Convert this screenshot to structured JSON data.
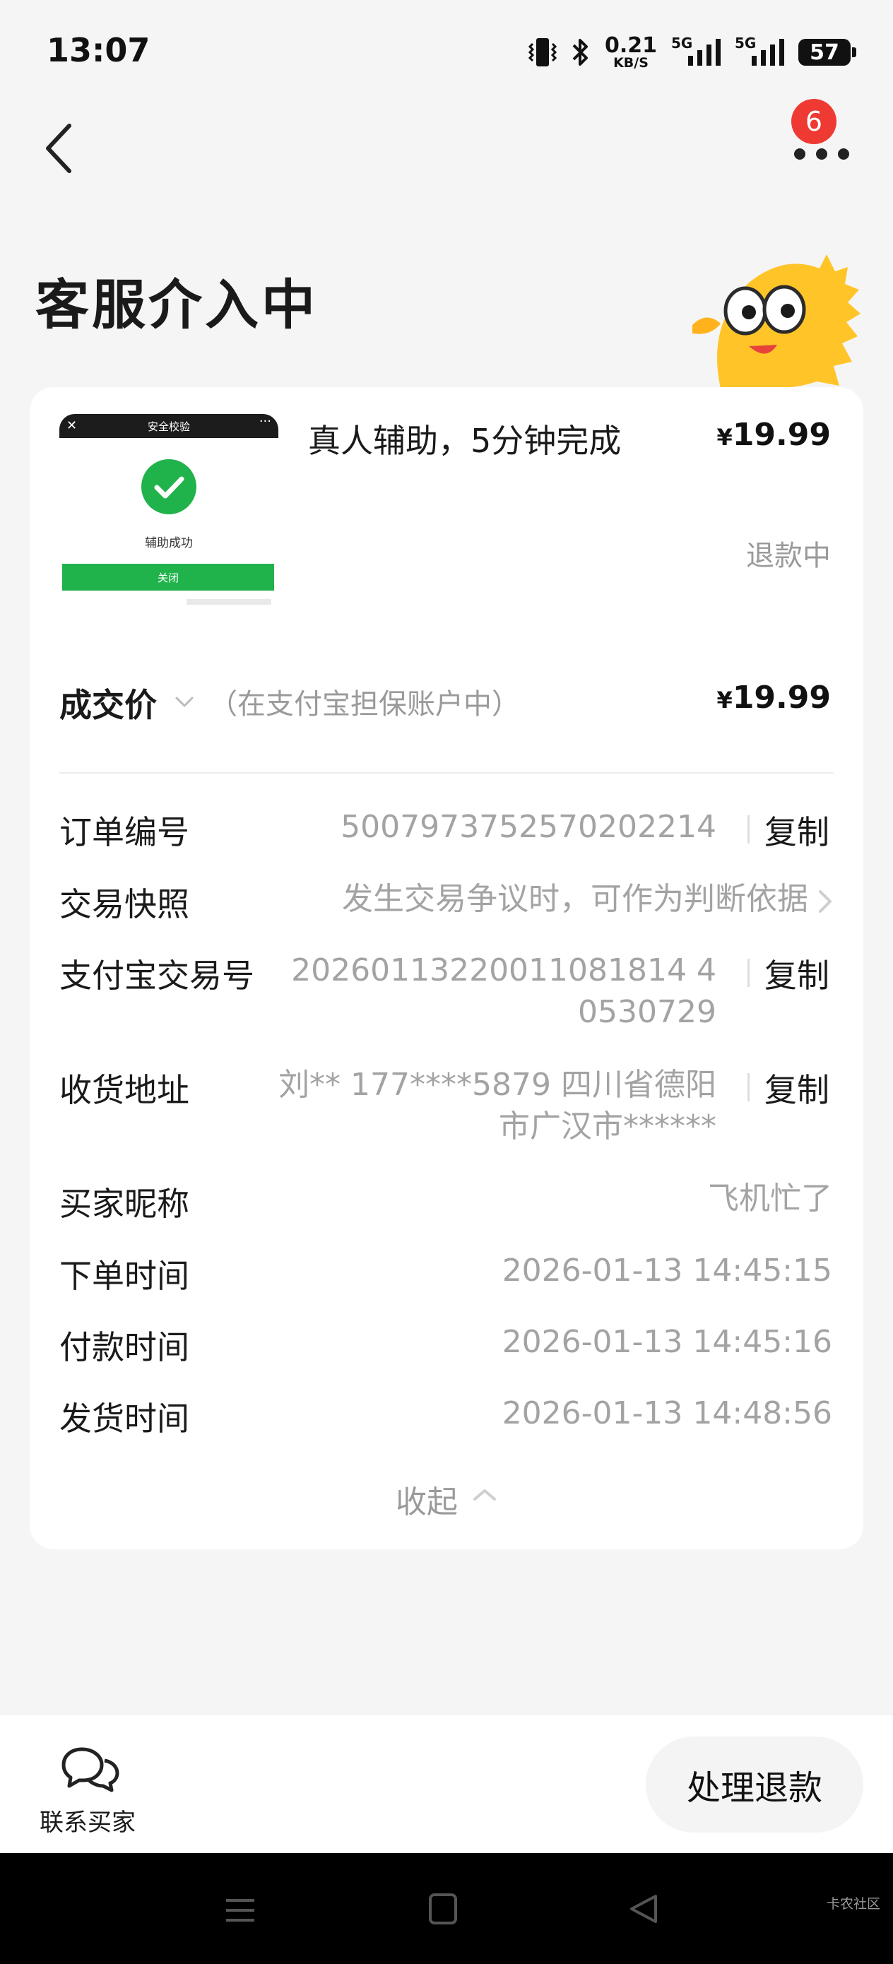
{
  "status_bar": {
    "time": "13:07",
    "net_speed_value": "0.21",
    "net_speed_unit": "KB/S",
    "signal1_label": "5G",
    "signal2_label": "5G",
    "battery": "57"
  },
  "header": {
    "notification_count": "6",
    "title": "客服介入中"
  },
  "product": {
    "thumbnail": {
      "header": "安全校验",
      "text": "辅助成功",
      "button": "关闭"
    },
    "title": "真人辅助，5分钟完成",
    "price_symbol": "¥",
    "price": "19.99",
    "status": "退款中"
  },
  "deal": {
    "label": "成交价",
    "note": "（在支付宝担保账户中）",
    "price_symbol": "¥",
    "price": "19.99"
  },
  "details": {
    "order_no": {
      "label": "订单编号",
      "value": "5007973752570202214",
      "action": "复制"
    },
    "snapshot": {
      "label": "交易快照",
      "value": "发生交易争议时，可作为判断依据"
    },
    "alipay_no": {
      "label": "支付宝交易号",
      "value_line1": "20260113220011081814 4",
      "value_line2": "0530729",
      "action": "复制"
    },
    "address": {
      "label": "收货地址",
      "value_line1": "刘** 177****5879 四川省德阳",
      "value_line2": "市广汉市******",
      "action": "复制"
    },
    "buyer_nick": {
      "label": "买家昵称",
      "value": "飞机忙了"
    },
    "order_time": {
      "label": "下单时间",
      "value": "2026-01-13 14:45:15"
    },
    "pay_time": {
      "label": "付款时间",
      "value": "2026-01-13 14:45:16"
    },
    "ship_time": {
      "label": "发货时间",
      "value": "2026-01-13 14:48:56"
    }
  },
  "collapse_label": "收起",
  "bottom": {
    "contact_label": "联系买家",
    "refund_button": "处理退款"
  },
  "watermark": "卡农社区"
}
